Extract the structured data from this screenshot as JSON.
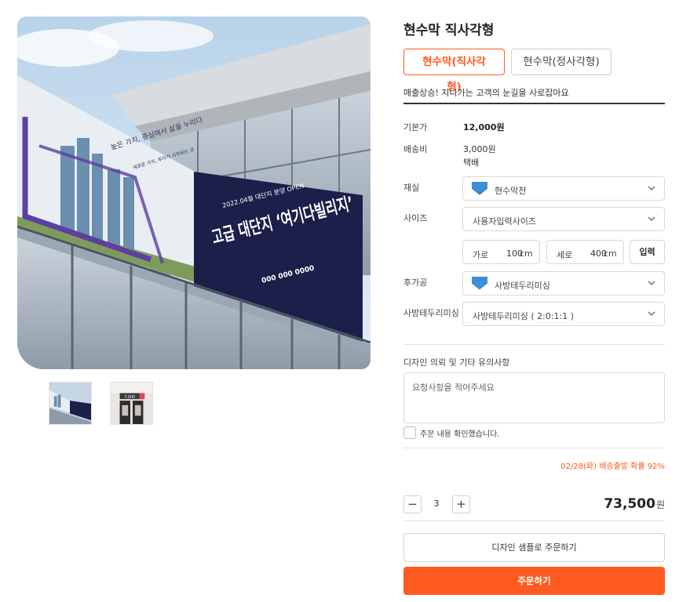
{
  "gallery": {
    "banner": {
      "brand_line": "2022.04월 대단지 분양 OPEN",
      "headline": "고급 대단지 ‘여기다빌리지’",
      "phone": "000 000 0000",
      "slogan_1": "높은 가치, 중심에서 삶을 누리다",
      "slogan_2": "새로운 가치, 투자가 시작되는 곳"
    },
    "thumbnail_2_sign": "7,000"
  },
  "product": {
    "title": "현수막 직사각형",
    "tabs": [
      {
        "label": "현수막(직사각형)",
        "active": true
      },
      {
        "label": "현수막(정사각형)",
        "active": false
      }
    ],
    "tagline": "매출상승! 지나가는 고객의 눈길을 사로잡아요"
  },
  "pricing": {
    "base_label": "기본가",
    "base_value": "12,000원",
    "shipping_label": "배송비",
    "shipping_value": "3,000원",
    "shipping_method": "택배"
  },
  "options": {
    "material": {
      "label": "재실",
      "value": "현수막천",
      "icon": "fabric-swatch-icon"
    },
    "size": {
      "label": "사이즈",
      "value": "사용자입력사이즈"
    },
    "width": {
      "label": "가로",
      "value": "100",
      "unit": "cm"
    },
    "height": {
      "label": "세로",
      "value": "400",
      "unit": "cm"
    },
    "enter_label": "입력",
    "finishing": {
      "label": "후가공",
      "value": "사방테두리미싱",
      "icon": "stitch-edge-icon"
    },
    "edge_sewing": {
      "label": "사방테두리미싱",
      "value": "사방테두리미싱 ( 2:0:1:1 )"
    }
  },
  "request": {
    "label": "디자인 의뢰 및 기타 유의사항",
    "placeholder": "요청사항을 적어주세요",
    "confirm_label": "주문 내용 확인했습니다."
  },
  "delivery_note": "02/28(화) 배송출발 확률 92%",
  "order": {
    "quantity": "3",
    "minus": "−",
    "plus": "+",
    "total": "73,500",
    "currency": "원",
    "sample_button": "디자인 샘플로 주문하기",
    "order_button": "주문하기"
  },
  "colors": {
    "accent": "#ff5a1f",
    "banner_navy": "#1b1f4a",
    "banner_purple": "#5d3fa0"
  }
}
